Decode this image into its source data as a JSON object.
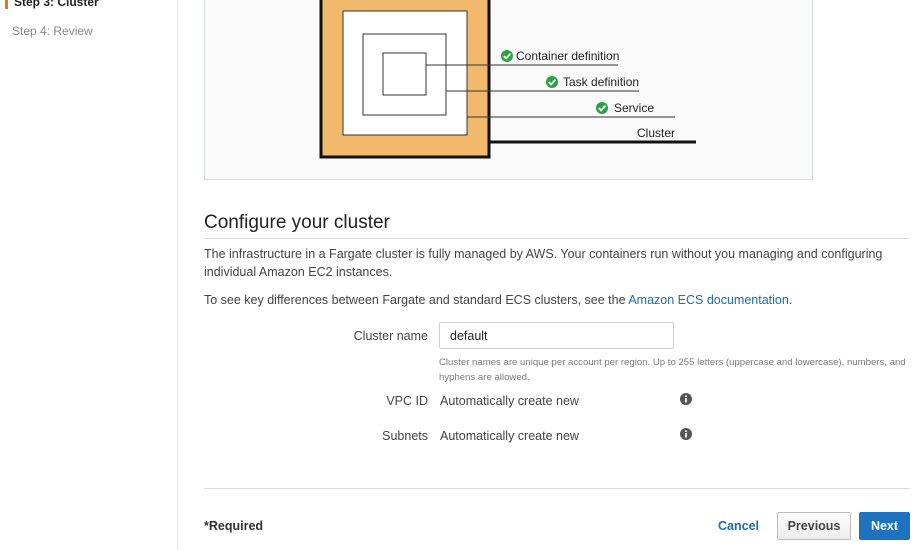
{
  "sidebar": {
    "current_step": "Step 3: Cluster",
    "next_step": "Step 4: Review"
  },
  "diagram": {
    "labels": {
      "container": "Container definition",
      "task": "Task definition",
      "service": "Service",
      "cluster": "Cluster"
    },
    "colors": {
      "cluster_fill": "#f0b96b",
      "check_green": "#29a340"
    },
    "icons": [
      "check-circle-icon"
    ]
  },
  "main": {
    "title": "Configure your cluster",
    "description": "The infrastructure in a Fargate cluster is fully managed by AWS. Your containers run without you managing and configuring individual Amazon EC2 instances.",
    "differences_prefix": "To see key differences between Fargate and standard ECS clusters, see the ",
    "differences_link": "Amazon ECS documentation",
    "differences_suffix": "."
  },
  "form": {
    "cluster_name_label": "Cluster name",
    "cluster_name_value": "default",
    "cluster_name_help": "Cluster names are unique per account per region. Up to 255 letters (uppercase and lowercase), numbers, and hyphens are allowed.",
    "vpc_label": "VPC ID",
    "vpc_value": "Automatically create new",
    "subnets_label": "Subnets",
    "subnets_value": "Automatically create new"
  },
  "footer": {
    "required": "*Required",
    "cancel": "Cancel",
    "previous": "Previous",
    "next": "Next"
  },
  "colors": {
    "accent": "#ec7211",
    "primary_button": "#1e73be",
    "link": "#1b6bb7"
  }
}
